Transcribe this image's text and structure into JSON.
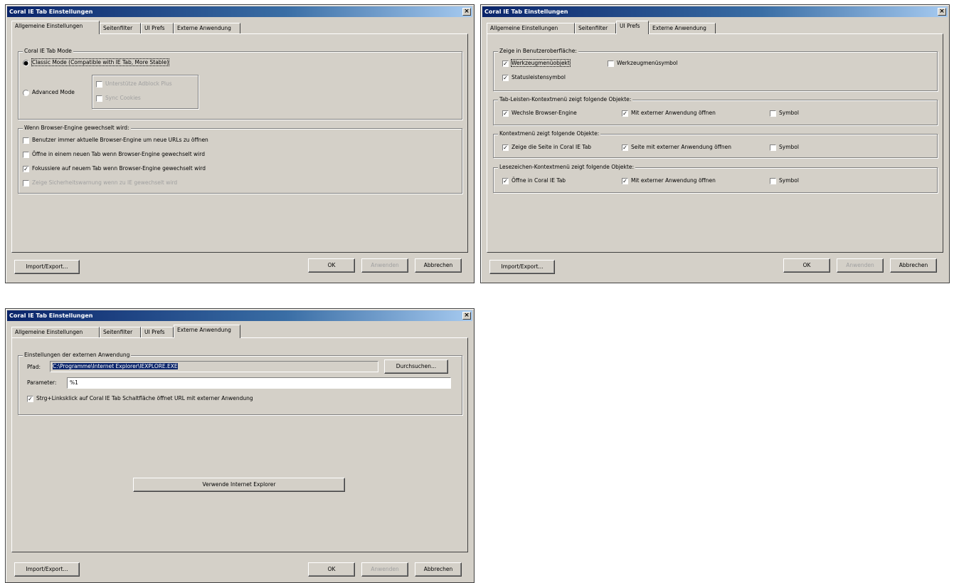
{
  "window_title": "Coral IE Tab Einstellungen",
  "close_glyph": "×",
  "tabs": [
    "Allgemeine Einstellungen",
    "Seitenfilter",
    "UI Prefs",
    "Externe Anwendung"
  ],
  "buttons": {
    "import_export": "Import/Export...",
    "ok": "OK",
    "apply": "Anwenden",
    "cancel": "Abbrechen"
  },
  "general": {
    "mode_group": "Coral IE Tab Mode",
    "classic_mode": "Classic Mode (Compatible with IE Tab, More Stable)",
    "advanced_mode": "Advanced Mode",
    "adblock": "Unterstütze Adblock Plus",
    "sync_cookies": "Sync Cookies",
    "engine_group": "Wenn Browser-Engine gewechselt wird:",
    "engine_options": [
      {
        "label": "Benutzer immer aktuelle Browser-Engine um neue URLs zu öffnen",
        "checked": false,
        "disabled": false
      },
      {
        "label": "Öffne in einem neuen Tab wenn Browser-Engine gewechselt wird",
        "checked": false,
        "disabled": false
      },
      {
        "label": "Fokussiere auf neuem Tab wenn Browser-Engine gewechselt wird",
        "checked": true,
        "disabled": false
      },
      {
        "label": "Zeige Sicherheitswarnung wenn zu IE gewechselt wird",
        "checked": false,
        "disabled": true
      }
    ]
  },
  "ui_prefs": {
    "show_group": "Zeige in Benutzeroberfläche:",
    "toolbar_item": "Werkzeugmenüobjekt",
    "toolbar_symbol": "Werkzeugmenüsymbol",
    "statusbar_symbol": "Statusleistensymbol",
    "tabbar_group": "Tab-Leisten-Kontextmenü zeigt folgende Objekte:",
    "switch_engine": "Wechsle Browser-Engine",
    "open_external": "Mit externer Anwendung öffnen",
    "symbol": "Symbol",
    "context_group": "Kontextmenü zeigt folgende Objekte:",
    "show_page_in_coral": "Zeige die Seite in Coral IE Tab",
    "page_external": "Seite mit externer Anwendung öffnen",
    "bookmark_group": "Lesezeichen-Kontextmenü zeigt folgende Objekte:",
    "open_in_coral": "Öffne in Coral IE Tab"
  },
  "external": {
    "group": "Einstellungen der externen Anwendung",
    "path_label": "Pfad:",
    "path_value": "C:\\Programme\\Internet Explorer\\IEXPLORE.EXE",
    "browse": "Durchsuchen...",
    "param_label": "Parameter:",
    "param_value": "%1",
    "ctrl_click": "Strg+Linksklick auf Coral IE Tab Schaltfläche öffnet URL mit externer Anwendung",
    "use_ie": "Verwende Internet Explorer"
  }
}
